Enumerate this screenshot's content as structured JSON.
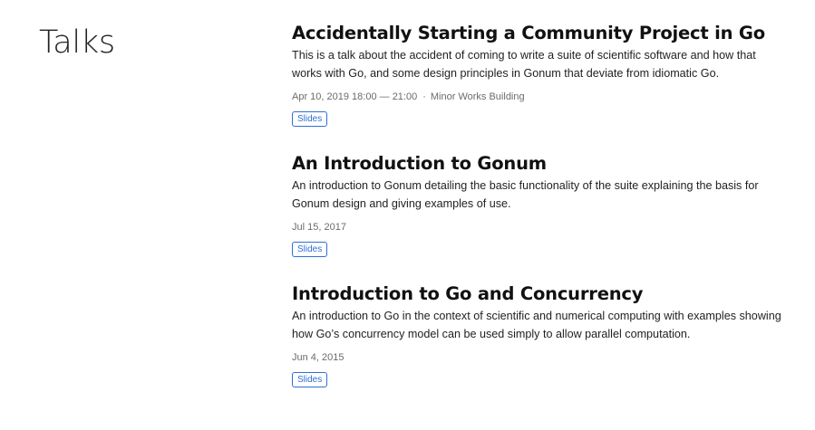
{
  "page": {
    "title": "Talks"
  },
  "talks": [
    {
      "title": "Accidentally Starting a Community Project in Go",
      "description": "This is a talk about the accident of coming to write a suite of scientific software and how that works with Go, and some design principles in Gonum that deviate from idiomatic Go.",
      "date": "Apr 10, 2019 18:00 — 21:00",
      "location": "Minor Works Building",
      "separator": "·",
      "link_label": "Slides"
    },
    {
      "title": "An Introduction to Gonum",
      "description": "An introduction to Gonum detailing the basic functionality of the suite explaining the basis for Gonum design and giving examples of use.",
      "date": "Jul 15, 2017",
      "link_label": "Slides"
    },
    {
      "title": "Introduction to Go and Concurrency",
      "description": "An introduction to Go in the context of scientific and numerical computing with examples showing how Go’s concurrency model can be used simply to allow parallel computation.",
      "date": "Jun 4, 2015",
      "link_label": "Slides"
    }
  ],
  "colors": {
    "link": "#2f6fd6",
    "meta_text": "#6b6b6b",
    "heading": "#111111"
  }
}
